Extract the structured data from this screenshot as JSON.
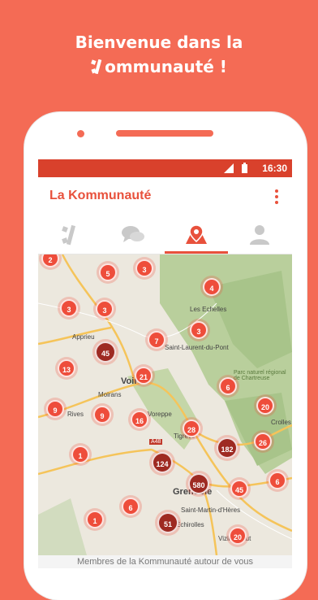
{
  "banner": {
    "line1": "Bienvenue dans la",
    "line2_rest": "ommunauté !",
    "logo_icon": "k-asterisk-icon"
  },
  "status_bar": {
    "time": "16:30"
  },
  "app_bar": {
    "title": "La Kommunauté",
    "menu_icon": "more-vert-icon"
  },
  "tabs": [
    {
      "name": "communaute",
      "icon": "k-asterisk-icon",
      "active": false
    },
    {
      "name": "messages",
      "icon": "chat-bubbles-icon",
      "active": false
    },
    {
      "name": "carte",
      "icon": "map-pin-icon",
      "active": true
    },
    {
      "name": "profil",
      "icon": "person-icon",
      "active": false
    }
  ],
  "map": {
    "places": [
      "Les Echelles",
      "Saint-Laurent-du-Pont",
      "Apprieu",
      "Voiron",
      "Moirans",
      "Rives",
      "Voreppe",
      "Crolles",
      "Grenoble",
      "Saint-Martin-d'Hères",
      "Échirolles",
      "Vizille-Haut",
      "A48",
      "Parc naturel régional de Chartreuse",
      "Tigrève"
    ],
    "markers": [
      {
        "label": "2",
        "dark": false
      },
      {
        "label": "5",
        "dark": false
      },
      {
        "label": "3",
        "dark": false
      },
      {
        "label": "4",
        "dark": false
      },
      {
        "label": "3",
        "dark": false
      },
      {
        "label": "3",
        "dark": false
      },
      {
        "label": "3",
        "dark": false
      },
      {
        "label": "45",
        "dark": true
      },
      {
        "label": "7",
        "dark": false
      },
      {
        "label": "13",
        "dark": false
      },
      {
        "label": "21",
        "dark": false
      },
      {
        "label": "6",
        "dark": false
      },
      {
        "label": "9",
        "dark": false
      },
      {
        "label": "9",
        "dark": false
      },
      {
        "label": "16",
        "dark": false
      },
      {
        "label": "20",
        "dark": false
      },
      {
        "label": "28",
        "dark": false
      },
      {
        "label": "1",
        "dark": false
      },
      {
        "label": "182",
        "dark": true
      },
      {
        "label": "26",
        "dark": false
      },
      {
        "label": "124",
        "dark": true
      },
      {
        "label": "580",
        "dark": true
      },
      {
        "label": "45",
        "dark": false
      },
      {
        "label": "6",
        "dark": false
      },
      {
        "label": "1",
        "dark": false
      },
      {
        "label": "6",
        "dark": false
      },
      {
        "label": "51",
        "dark": true
      },
      {
        "label": "20",
        "dark": false
      }
    ]
  },
  "caption": "Membres de la Kommunauté autour de vous",
  "colors": {
    "brand": "#f46b55",
    "accent": "#e8513c",
    "status_bar": "#d9412c",
    "marker": "#ee4d3b",
    "marker_dark": "#9e2a22"
  }
}
